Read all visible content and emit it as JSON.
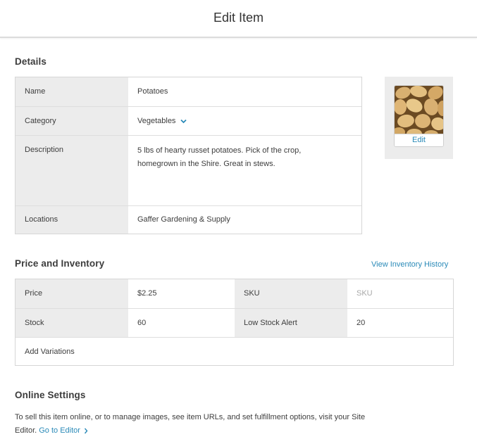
{
  "header": {
    "title": "Edit Item"
  },
  "details": {
    "title": "Details",
    "name_label": "Name",
    "name_value": "Potatoes",
    "category_label": "Category",
    "category_value": "Vegetables",
    "description_label": "Description",
    "description_value": "5 lbs of hearty russet potatoes. Pick of the crop, homegrown in the Shire. Great in stews.",
    "locations_label": "Locations",
    "locations_value": "Gaffer Gardening & Supply"
  },
  "image": {
    "edit_label": "Edit",
    "icon": "potatoes-photo"
  },
  "price_inventory": {
    "title": "Price and Inventory",
    "view_history_link": "View Inventory History",
    "price_label": "Price",
    "price_value": "$2.25",
    "sku_label": "SKU",
    "sku_placeholder": "SKU",
    "stock_label": "Stock",
    "stock_value": "60",
    "low_stock_label": "Low Stock Alert",
    "low_stock_value": "20",
    "add_variations": "Add Variations"
  },
  "online_settings": {
    "title": "Online Settings",
    "text": "To sell this item online, or to manage images, see item URLs, and set fulfillment options, visit your Site Editor.",
    "link": "Go to Editor"
  },
  "colors": {
    "link": "#2a8ab8",
    "label_bg": "#ececec",
    "border": "#d6d6d6"
  }
}
